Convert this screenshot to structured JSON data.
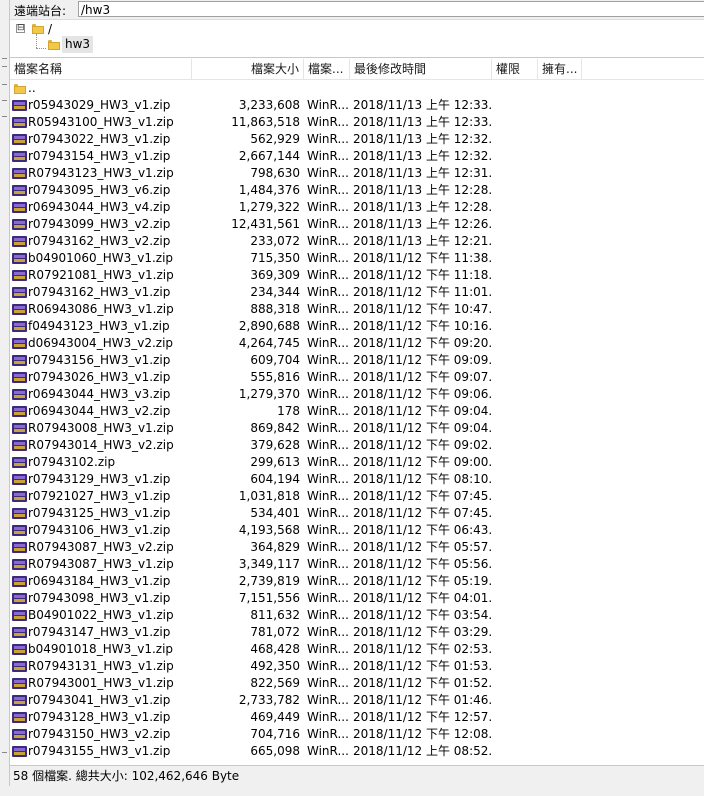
{
  "remote_site": {
    "label": "遠端站台:",
    "path": "/hw3"
  },
  "tree": {
    "expander": "⊟",
    "root": "/",
    "child": "hw3"
  },
  "columns": [
    "檔案名稱",
    "檔案大小",
    "檔案...",
    "最後修改時間",
    "權限",
    "擁有..."
  ],
  "parent_dir": "..",
  "files": [
    {
      "name": "r05943029_HW3_v1.zip",
      "size": "3,233,608",
      "type": "WinR...",
      "modified": "2018/11/13 上午 12:33..."
    },
    {
      "name": "R05943100_HW3_v1.zip",
      "size": "11,863,518",
      "type": "WinR...",
      "modified": "2018/11/13 上午 12:33..."
    },
    {
      "name": "r07943022_HW3_v1.zip",
      "size": "562,929",
      "type": "WinR...",
      "modified": "2018/11/13 上午 12:32..."
    },
    {
      "name": "r07943154_HW3_v1.zip",
      "size": "2,667,144",
      "type": "WinR...",
      "modified": "2018/11/13 上午 12:32..."
    },
    {
      "name": "R07943123_HW3_v1.zip",
      "size": "798,630",
      "type": "WinR...",
      "modified": "2018/11/13 上午 12:31..."
    },
    {
      "name": "r07943095_HW3_v6.zip",
      "size": "1,484,376",
      "type": "WinR...",
      "modified": "2018/11/13 上午 12:28..."
    },
    {
      "name": "r06943044_HW3_v4.zip",
      "size": "1,279,322",
      "type": "WinR...",
      "modified": "2018/11/13 上午 12:28..."
    },
    {
      "name": "r07943099_HW3_v2.zip",
      "size": "12,431,561",
      "type": "WinR...",
      "modified": "2018/11/13 上午 12:26..."
    },
    {
      "name": "r07943162_HW3_v2.zip",
      "size": "233,072",
      "type": "WinR...",
      "modified": "2018/11/13 上午 12:21..."
    },
    {
      "name": "b04901060_HW3_v1.zip",
      "size": "715,350",
      "type": "WinR...",
      "modified": "2018/11/12 下午 11:38..."
    },
    {
      "name": "R07921081_HW3_v1.zip",
      "size": "369,309",
      "type": "WinR...",
      "modified": "2018/11/12 下午 11:18..."
    },
    {
      "name": "r07943162_HW3_v1.zip",
      "size": "234,344",
      "type": "WinR...",
      "modified": "2018/11/12 下午 11:01..."
    },
    {
      "name": "R06943086_HW3_v1.zip",
      "size": "888,318",
      "type": "WinR...",
      "modified": "2018/11/12 下午 10:47..."
    },
    {
      "name": "f04943123_HW3_v1.zip",
      "size": "2,890,688",
      "type": "WinR...",
      "modified": "2018/11/12 下午 10:16..."
    },
    {
      "name": "d06943004_HW3_v2.zip",
      "size": "4,264,745",
      "type": "WinR...",
      "modified": "2018/11/12 下午 09:20..."
    },
    {
      "name": "r07943156_HW3_v1.zip",
      "size": "609,704",
      "type": "WinR...",
      "modified": "2018/11/12 下午 09:09..."
    },
    {
      "name": "r07943026_HW3_v1.zip",
      "size": "555,816",
      "type": "WinR...",
      "modified": "2018/11/12 下午 09:07..."
    },
    {
      "name": "r06943044_HW3_v3.zip",
      "size": "1,279,370",
      "type": "WinR...",
      "modified": "2018/11/12 下午 09:06..."
    },
    {
      "name": "r06943044_HW3_v2.zip",
      "size": "178",
      "type": "WinR...",
      "modified": "2018/11/12 下午 09:04..."
    },
    {
      "name": "R07943008_HW3_v1.zip",
      "size": "869,842",
      "type": "WinR...",
      "modified": "2018/11/12 下午 09:04..."
    },
    {
      "name": "R07943014_HW3_v2.zip",
      "size": "379,628",
      "type": "WinR...",
      "modified": "2018/11/12 下午 09:02..."
    },
    {
      "name": "r07943102.zip",
      "size": "299,613",
      "type": "WinR...",
      "modified": "2018/11/12 下午 09:00..."
    },
    {
      "name": "r07943129_HW3_v1.zip",
      "size": "604,194",
      "type": "WinR...",
      "modified": "2018/11/12 下午 08:10..."
    },
    {
      "name": "r07921027_HW3_v1.zip",
      "size": "1,031,818",
      "type": "WinR...",
      "modified": "2018/11/12 下午 07:45..."
    },
    {
      "name": "r07943125_HW3_v1.zip",
      "size": "534,401",
      "type": "WinR...",
      "modified": "2018/11/12 下午 07:45..."
    },
    {
      "name": "r07943106_HW3_v1.zip",
      "size": "4,193,568",
      "type": "WinR...",
      "modified": "2018/11/12 下午 06:43..."
    },
    {
      "name": "R07943087_HW3_v2.zip",
      "size": "364,829",
      "type": "WinR...",
      "modified": "2018/11/12 下午 05:57..."
    },
    {
      "name": "R07943087_HW3_v1.zip",
      "size": "3,349,117",
      "type": "WinR...",
      "modified": "2018/11/12 下午 05:56..."
    },
    {
      "name": "r06943184_HW3_v1.zip",
      "size": "2,739,819",
      "type": "WinR...",
      "modified": "2018/11/12 下午 05:19..."
    },
    {
      "name": "r07943098_HW3_v1.zip",
      "size": "7,151,556",
      "type": "WinR...",
      "modified": "2018/11/12 下午 04:01..."
    },
    {
      "name": "B04901022_HW3_v1.zip",
      "size": "811,632",
      "type": "WinR...",
      "modified": "2018/11/12 下午 03:54..."
    },
    {
      "name": "r07943147_HW3_v1.zip",
      "size": "781,072",
      "type": "WinR...",
      "modified": "2018/11/12 下午 03:29..."
    },
    {
      "name": "b04901018_HW3_v1.zip",
      "size": "468,428",
      "type": "WinR...",
      "modified": "2018/11/12 下午 02:53..."
    },
    {
      "name": "R07943131_HW3_v1.zip",
      "size": "492,350",
      "type": "WinR...",
      "modified": "2018/11/12 下午 01:53..."
    },
    {
      "name": "R07943001_HW3_v1.zip",
      "size": "822,569",
      "type": "WinR...",
      "modified": "2018/11/12 下午 01:52..."
    },
    {
      "name": "r07943041_HW3_v1.zip",
      "size": "2,733,782",
      "type": "WinR...",
      "modified": "2018/11/12 下午 01:46..."
    },
    {
      "name": "r07943128_HW3_v1.zip",
      "size": "469,449",
      "type": "WinR...",
      "modified": "2018/11/12 下午 12:57..."
    },
    {
      "name": "r07943150_HW3_v2.zip",
      "size": "704,716",
      "type": "WinR...",
      "modified": "2018/11/12 下午 12:08..."
    },
    {
      "name": "r07943155_HW3_v1.zip",
      "size": "665,098",
      "type": "WinR...",
      "modified": "2018/11/12 上午 08:52..."
    }
  ],
  "status": "58 個檔案. 總共大小: 102,462,646 Byte"
}
